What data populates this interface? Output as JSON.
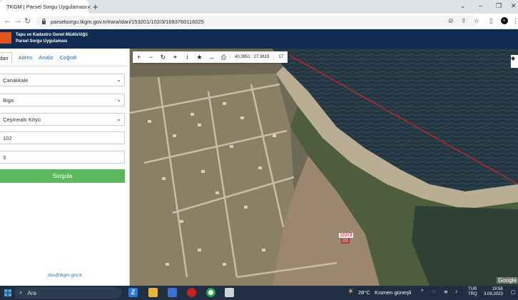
{
  "browser": {
    "tab_title": "TKGM | Parsel Sorgu Uygulaması",
    "url": "parselsorgu.tkgm.gov.tr/#ara/idari/153201/102/3/1693760116025"
  },
  "header": {
    "line1": "Tapu ve Kadastro Genel Müdürlüğü",
    "line2": "Parsel Sorgu Uygulaması"
  },
  "sidebar": {
    "tabs": [
      {
        "label": "İdari",
        "active": true
      },
      {
        "label": "Adres"
      },
      {
        "label": "Analiz"
      },
      {
        "label": "Coğrafi"
      }
    ],
    "fields": [
      {
        "value": "Çanakkale",
        "type": "select"
      },
      {
        "value": "Biga",
        "type": "select"
      },
      {
        "value": "Çeşmealtı Köyü",
        "type": "select"
      },
      {
        "value": "102",
        "type": "input"
      },
      {
        "value": "3",
        "type": "input"
      }
    ],
    "search_button": "Sorgula",
    "email": "cbs@tkgm.gov.tr"
  },
  "map": {
    "coordinates": "40.3851 : 27.3819",
    "zoom": "17",
    "parcel_label": "102/3",
    "attribution": "Google"
  },
  "taskbar": {
    "search_label": "Ara",
    "weather_temp": "28°C",
    "weather_text": "Kısmen güneşli",
    "lang1": "TUR",
    "lang2": "TRQ",
    "time": "19:56",
    "date": "3.09.2023"
  }
}
